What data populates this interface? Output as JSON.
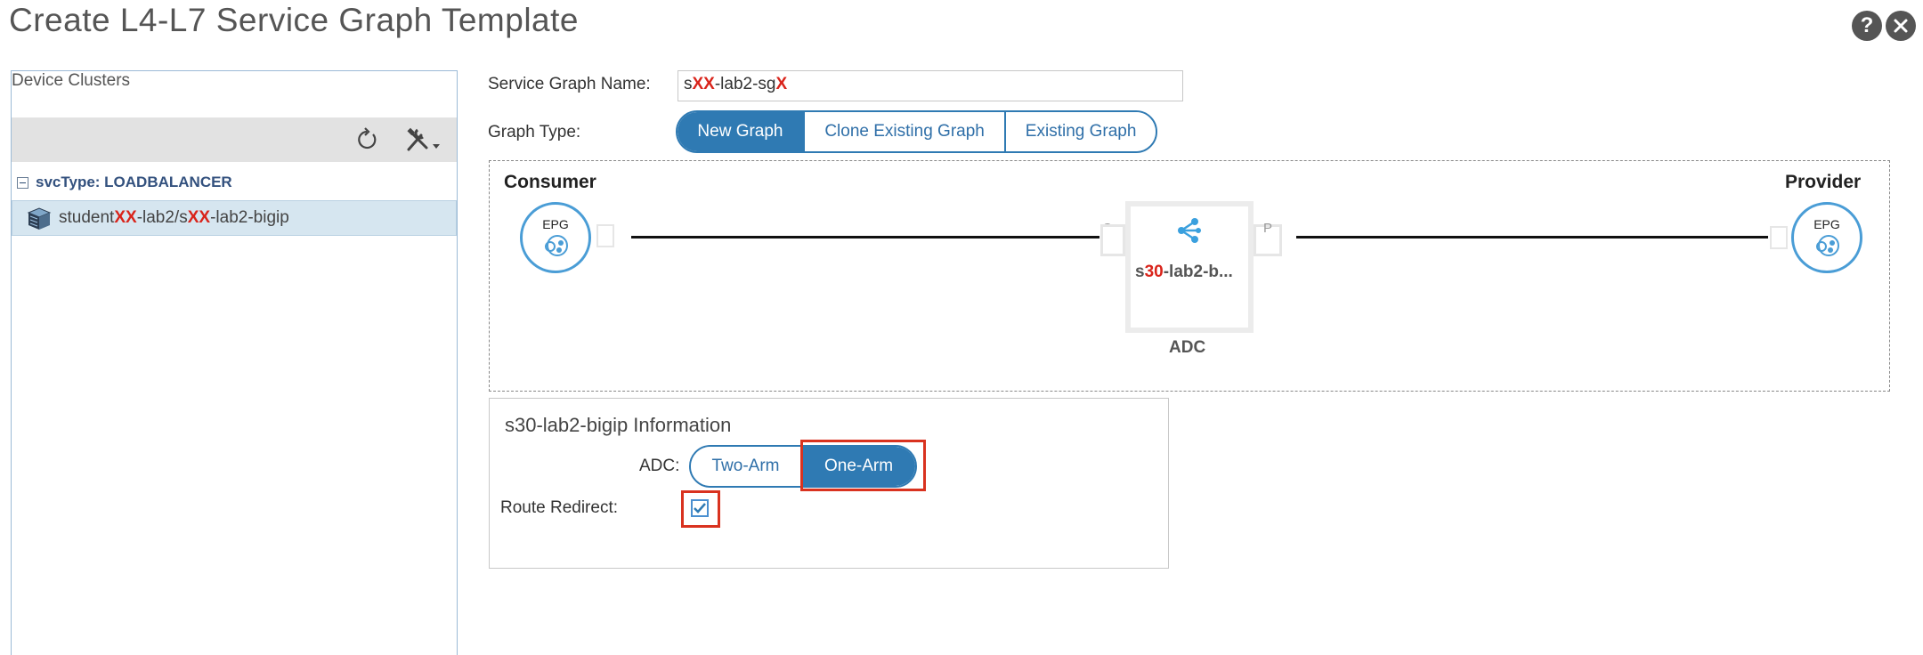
{
  "header": {
    "title": "Create L4-L7 Service Graph Template",
    "help_icon": "help-icon",
    "close_icon": "close-icon"
  },
  "device_clusters": {
    "title": "Device Clusters",
    "group_label": "svcType: LOADBALANCER",
    "item": {
      "prefix": "student",
      "redacted_1": "XX",
      "middle": "-lab2/s",
      "redacted_2": "XX",
      "suffix": "-lab2-bigip"
    }
  },
  "form": {
    "name_label": "Service Graph Name:",
    "name_value": {
      "prefix": "s",
      "redacted_1": "XX",
      "middle": "-lab2-sg",
      "redacted_2": "X"
    },
    "type_label": "Graph Type:",
    "type_options": [
      "New Graph",
      "Clone Existing Graph",
      "Existing Graph"
    ],
    "type_selected": "New Graph"
  },
  "graph": {
    "consumer_label": "Consumer",
    "provider_label": "Provider",
    "epg_label": "EPG",
    "node": {
      "name_prefix": "s",
      "name_redacted": "30",
      "name_suffix": "-lab2-b...",
      "type": "ADC",
      "consumer_conn": "C",
      "provider_conn": "P"
    }
  },
  "info": {
    "title": "s30-lab2-bigip Information",
    "adc_label": "ADC:",
    "adc_options": [
      "Two-Arm",
      "One-Arm"
    ],
    "adc_selected": "One-Arm",
    "route_redirect_label": "Route Redirect:",
    "route_redirect_checked": true
  },
  "colors": {
    "accent": "#2f7ab3",
    "highlight": "#d9321f",
    "redaction": "#d9241b"
  }
}
